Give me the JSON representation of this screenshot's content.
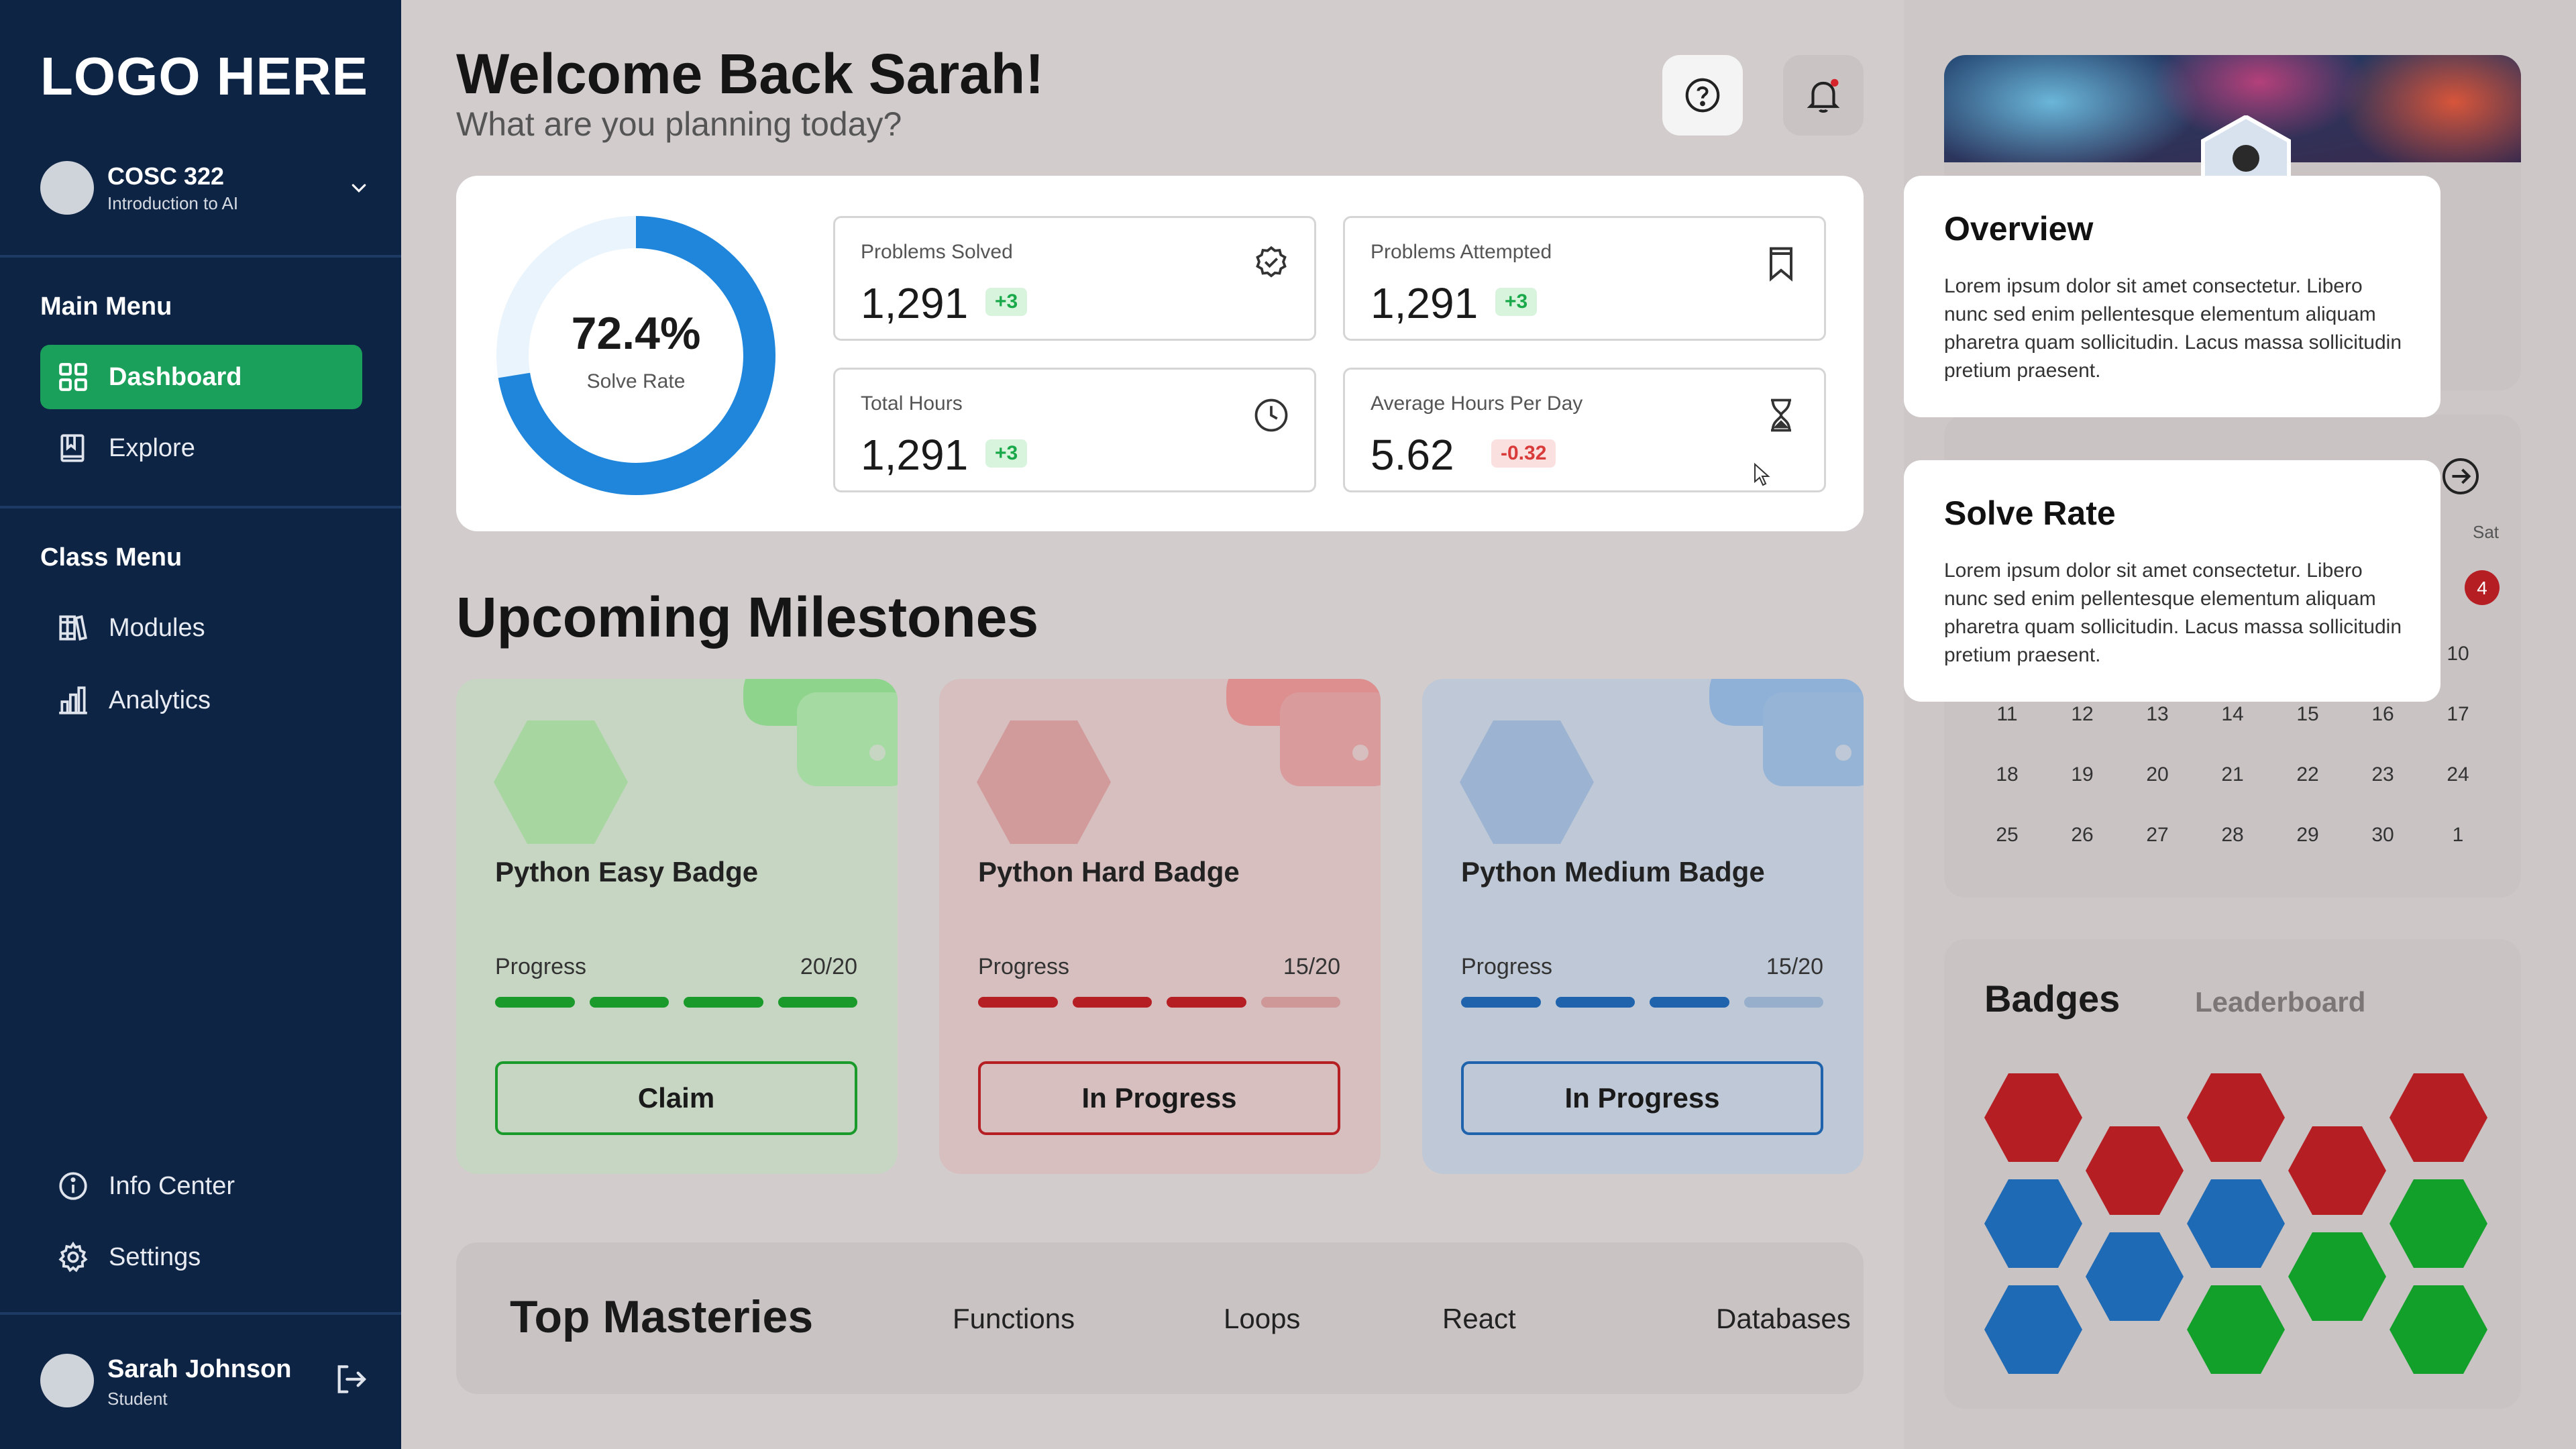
{
  "sidebar": {
    "logo": "LOGO HERE",
    "course": {
      "code": "COSC 322",
      "name": "Introduction to AI"
    },
    "main_menu": {
      "heading": "Main Menu",
      "items": [
        {
          "label": "Dashboard",
          "icon": "grid-icon",
          "active": true
        },
        {
          "label": "Explore",
          "icon": "book-icon",
          "active": false
        }
      ]
    },
    "class_menu": {
      "heading": "Class Menu",
      "items": [
        {
          "label": "Modules",
          "icon": "books-icon"
        },
        {
          "label": "Analytics",
          "icon": "bar-chart-icon"
        }
      ]
    },
    "bottom_items": [
      {
        "label": "Info Center",
        "icon": "info-icon"
      },
      {
        "label": "Settings",
        "icon": "gear-icon"
      }
    ],
    "user": {
      "name": "Sarah Johnson",
      "role": "Student"
    }
  },
  "header": {
    "welcome": "Welcome Back Sarah!",
    "subtitle": "What are you planning today?"
  },
  "stats": {
    "solve_rate": {
      "value": "72.4%",
      "label": "Solve Rate",
      "fraction": 0.724
    },
    "cards": [
      {
        "label": "Problems Solved",
        "value": "1,291",
        "delta": "+3",
        "icon": "badge-check-icon"
      },
      {
        "label": "Problems Attempted",
        "value": "1,291",
        "delta": "+3",
        "icon": "bookmark-icon"
      },
      {
        "label": "Total Hours",
        "value": "1,291",
        "delta": "+3",
        "icon": "clock-icon"
      },
      {
        "label": "Average Hours Per Day",
        "value": "5.62",
        "delta": "-0.32",
        "icon": "hourglass-icon"
      }
    ]
  },
  "milestones": {
    "title": "Upcoming Milestones",
    "items": [
      {
        "title": "Python Easy Badge",
        "progress_label": "Progress",
        "progress": "20/20",
        "filled": 4,
        "button": "Claim",
        "color": "#1a9a2a"
      },
      {
        "title": "Python Hard Badge",
        "progress_label": "Progress",
        "progress": "15/20",
        "filled": 3,
        "button": "In Progress",
        "color": "#b51f24"
      },
      {
        "title": "Python Medium Badge",
        "progress_label": "Progress",
        "progress": "15/20",
        "filled": 3,
        "button": "In Progress",
        "color": "#1f63ad"
      }
    ]
  },
  "masteries": {
    "title": "Top Masteries",
    "items": [
      "Functions",
      "Loops",
      "React",
      "Databases"
    ]
  },
  "calendar": {
    "day_label": "Sat",
    "highlight": "4",
    "weeks": [
      [
        "",
        "",
        "",
        "",
        "",
        "",
        "10"
      ],
      [
        "11",
        "12",
        "13",
        "14",
        "15",
        "16",
        "17"
      ],
      [
        "18",
        "19",
        "20",
        "21",
        "22",
        "23",
        "24"
      ],
      [
        "25",
        "26",
        "27",
        "28",
        "29",
        "30",
        "1"
      ]
    ]
  },
  "badges": {
    "title": "Badges",
    "tab": "Leaderboard",
    "colors": {
      "red": "#b51f24",
      "blue": "#1f6ab5",
      "green": "#12a02a"
    }
  },
  "popovers": [
    {
      "title": "Overview",
      "body": "Lorem ipsum dolor sit amet consectetur. Libero nunc sed enim pellentesque elementum aliquam pharetra quam sollicitudin. Lacus massa sollicitudin pretium praesent."
    },
    {
      "title": "Solve Rate",
      "body": "Lorem ipsum dolor sit amet consectetur. Libero nunc sed enim pellentesque elementum aliquam pharetra quam sollicitudin. Lacus massa sollicitudin pretium praesent."
    }
  ],
  "colors": {
    "sidebar": "#0e2445",
    "accent_green": "#1aa05a",
    "donut_blue": "#1f86dc"
  }
}
